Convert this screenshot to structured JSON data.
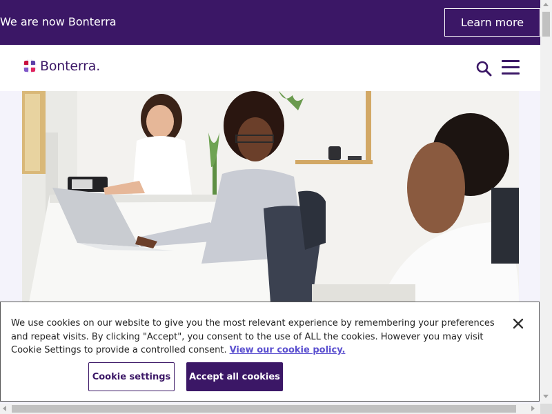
{
  "banner": {
    "text": "We are now Bonterra",
    "learn_more_label": "Learn more"
  },
  "header": {
    "logo_text": "Bonterra",
    "logo_suffix": "."
  },
  "cookie_banner": {
    "message": "We use cookies on our website to give you the most relevant experience by remembering your preferences and repeat visits. By clicking \"Accept\", you consent to the use of ALL the cookies. However you may visit Cookie Settings to provide a controlled consent.",
    "policy_link": "View our cookie policy.",
    "settings_label": "Cookie settings",
    "accept_label": "Accept all cookies"
  },
  "colors": {
    "brand_purple": "#3b1766",
    "link": "#5a4fcf"
  }
}
